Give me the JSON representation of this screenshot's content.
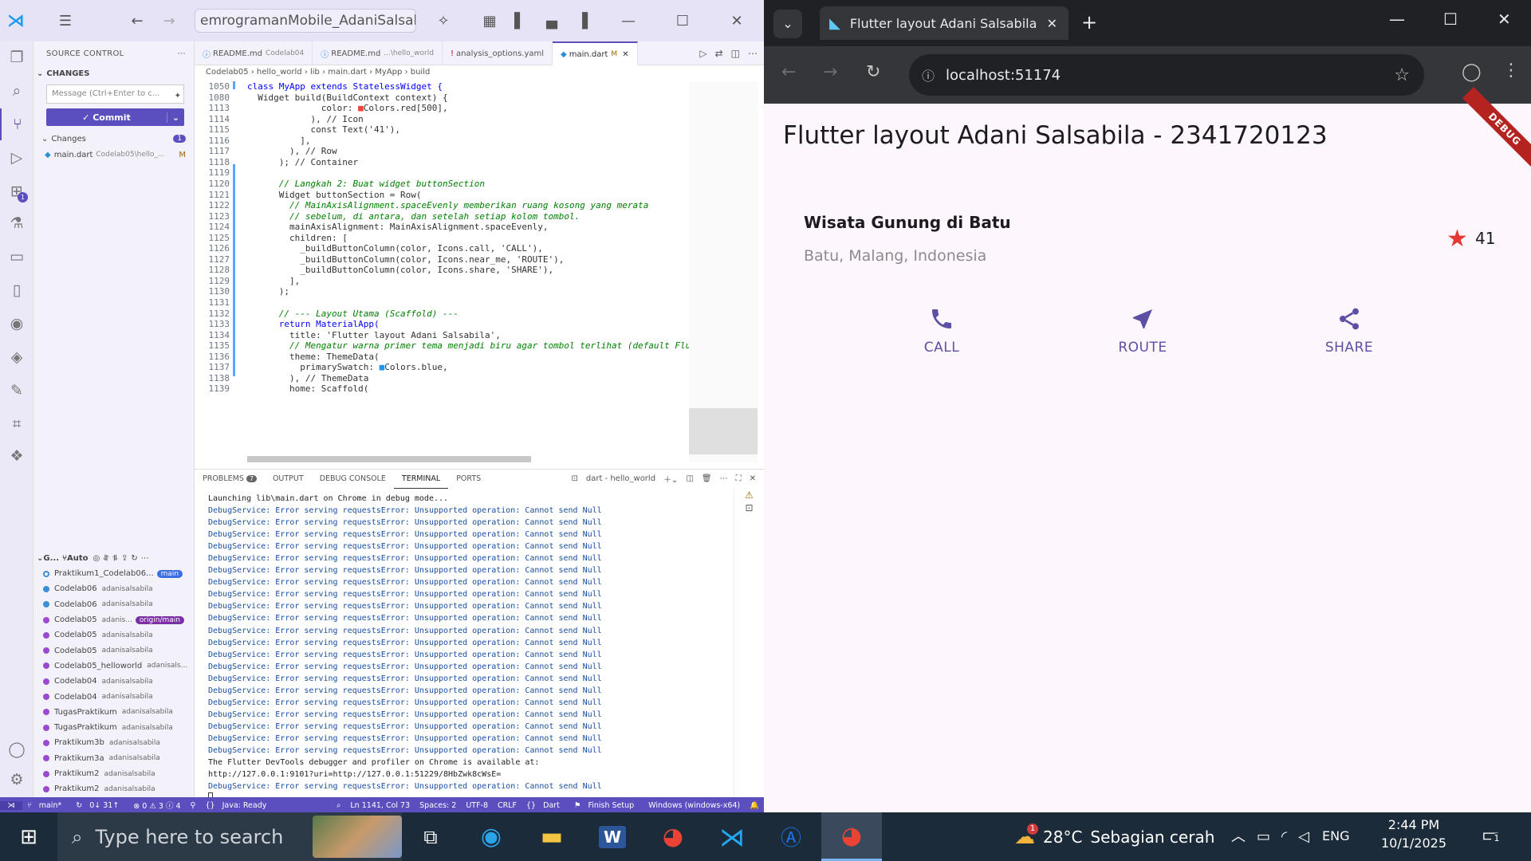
{
  "vscode": {
    "title_search": "emrogramanMobile_AdaniSalsabila",
    "sidebar": {
      "header": "SOURCE CONTROL",
      "changes_section": "CHANGES",
      "message_placeholder": "Message (Ctrl+Enter to c...",
      "commit_label": "Commit",
      "changes_group": "Changes",
      "changes_count": "1",
      "changed_file": "main.dart",
      "changed_file_path": "Codelab05\\hello_...",
      "changed_file_status": "M",
      "graph_header": "G...",
      "graph_auto": "Auto",
      "graph": [
        {
          "msg": "Praktikum1_Codelab06...",
          "author": "",
          "tag": "main"
        },
        {
          "msg": "Codelab06",
          "author": "adanisalsabila",
          "tag": ""
        },
        {
          "msg": "Codelab06",
          "author": "adanisalsabila",
          "tag": ""
        },
        {
          "msg": "Codelab05",
          "author": "adanis...",
          "tag": "origin/main"
        },
        {
          "msg": "Codelab05",
          "author": "adanisalsabila",
          "tag": ""
        },
        {
          "msg": "Codelab05",
          "author": "adanisalsabila",
          "tag": ""
        },
        {
          "msg": "Codelab05_helloworld",
          "author": "adanisals...",
          "tag": ""
        },
        {
          "msg": "Codelab04",
          "author": "adanisalsabila",
          "tag": ""
        },
        {
          "msg": "Codelab04",
          "author": "adanisalsabila",
          "tag": ""
        },
        {
          "msg": "TugasPraktikum",
          "author": "adanisalsabila",
          "tag": ""
        },
        {
          "msg": "TugasPraktikum",
          "author": "adanisalsabila",
          "tag": ""
        },
        {
          "msg": "Praktikum3b",
          "author": "adanisalsabila",
          "tag": ""
        },
        {
          "msg": "Praktikum3a",
          "author": "adanisalsabila",
          "tag": ""
        },
        {
          "msg": "Praktikum2",
          "author": "adanisalsabila",
          "tag": ""
        },
        {
          "msg": "Praktikum2",
          "author": "adanisalsabila",
          "tag": ""
        }
      ]
    },
    "tabs": [
      {
        "label": "README.md",
        "sub": "Codelab04"
      },
      {
        "label": "README.md",
        "sub": "...\\hello_world"
      },
      {
        "label": "analysis_options.yaml",
        "sub": ""
      },
      {
        "label": "main.dart",
        "sub": "M"
      }
    ],
    "breadcrumb": "Codelab05 › hello_world › lib › main.dart › MyApp › build",
    "code_lines": [
      {
        "n": "1050",
        "t": "class MyApp extends StatelessWidget {"
      },
      {
        "n": "1080",
        "t": "  Widget build(BuildContext context) {"
      },
      {
        "n": "1113",
        "t": "              color: ■Colors.red[500],"
      },
      {
        "n": "1114",
        "t": "            ), // Icon"
      },
      {
        "n": "1115",
        "t": "            const Text('41'),"
      },
      {
        "n": "1116",
        "t": "          ],"
      },
      {
        "n": "1117",
        "t": "        ), // Row"
      },
      {
        "n": "1118",
        "t": "      ); // Container"
      },
      {
        "n": "1119",
        "t": ""
      },
      {
        "n": "1120",
        "t": "      // Langkah 2: Buat widget buttonSection"
      },
      {
        "n": "1121",
        "t": "      Widget buttonSection = Row("
      },
      {
        "n": "1122",
        "t": "        // MainAxisAlignment.spaceEvenly memberikan ruang kosong yang merata"
      },
      {
        "n": "1123",
        "t": "        // sebelum, di antara, dan setelah setiap kolom tombol."
      },
      {
        "n": "1124",
        "t": "        mainAxisAlignment: MainAxisAlignment.spaceEvenly,"
      },
      {
        "n": "1125",
        "t": "        children: ["
      },
      {
        "n": "1126",
        "t": "          _buildButtonColumn(color, Icons.call, 'CALL'),"
      },
      {
        "n": "1127",
        "t": "          _buildButtonColumn(color, Icons.near_me, 'ROUTE'),"
      },
      {
        "n": "1128",
        "t": "          _buildButtonColumn(color, Icons.share, 'SHARE'),"
      },
      {
        "n": "1129",
        "t": "        ],"
      },
      {
        "n": "1130",
        "t": "      );"
      },
      {
        "n": "1131",
        "t": ""
      },
      {
        "n": "1132",
        "t": "      // --- Layout Utama (Scaffold) ---"
      },
      {
        "n": "1133",
        "t": "      return MaterialApp("
      },
      {
        "n": "1134",
        "t": "        title: 'Flutter layout Adani Salsabila',"
      },
      {
        "n": "1135",
        "t": "        // Mengatur warna primer tema menjadi biru agar tombol terlihat (default Flu"
      },
      {
        "n": "1136",
        "t": "        theme: ThemeData("
      },
      {
        "n": "1137",
        "t": "          primarySwatch: ■Colors.blue,"
      },
      {
        "n": "1138",
        "t": "        ), // ThemeData"
      },
      {
        "n": "1139",
        "t": "        home: Scaffold("
      }
    ],
    "panel": {
      "problems": "PROBLEMS",
      "problems_count": "7",
      "output": "OUTPUT",
      "debug_console": "DEBUG CONSOLE",
      "terminal": "TERMINAL",
      "ports": "PORTS",
      "terminal_name": "dart - hello_world"
    },
    "terminal_lines": [
      {
        "t": "Launching lib\\main.dart on Chrome in debug mode...",
        "c": "plain"
      },
      {
        "t": "DebugService: Error serving requestsError: Unsupported operation: Cannot send Null",
        "c": "blue"
      },
      {
        "t": "DebugService: Error serving requestsError: Unsupported operation: Cannot send Null",
        "c": "blue"
      },
      {
        "t": "DebugService: Error serving requestsError: Unsupported operation: Cannot send Null",
        "c": "blue"
      },
      {
        "t": "DebugService: Error serving requestsError: Unsupported operation: Cannot send Null",
        "c": "blue"
      },
      {
        "t": "DebugService: Error serving requestsError: Unsupported operation: Cannot send Null",
        "c": "blue"
      },
      {
        "t": "DebugService: Error serving requestsError: Unsupported operation: Cannot send Null",
        "c": "blue"
      },
      {
        "t": "DebugService: Error serving requestsError: Unsupported operation: Cannot send Null",
        "c": "blue"
      },
      {
        "t": "DebugService: Error serving requestsError: Unsupported operation: Cannot send Null",
        "c": "blue"
      },
      {
        "t": "DebugService: Error serving requestsError: Unsupported operation: Cannot send Null",
        "c": "blue"
      },
      {
        "t": "DebugService: Error serving requestsError: Unsupported operation: Cannot send Null",
        "c": "blue"
      },
      {
        "t": "DebugService: Error serving requestsError: Unsupported operation: Cannot send Null",
        "c": "blue"
      },
      {
        "t": "DebugService: Error serving requestsError: Unsupported operation: Cannot send Null",
        "c": "blue"
      },
      {
        "t": "DebugService: Error serving requestsError: Unsupported operation: Cannot send Null",
        "c": "blue"
      },
      {
        "t": "DebugService: Error serving requestsError: Unsupported operation: Cannot send Null",
        "c": "blue"
      },
      {
        "t": "DebugService: Error serving requestsError: Unsupported operation: Cannot send Null",
        "c": "blue"
      },
      {
        "t": "DebugService: Error serving requestsError: Unsupported operation: Cannot send Null",
        "c": "blue"
      },
      {
        "t": "DebugService: Error serving requestsError: Unsupported operation: Cannot send Null",
        "c": "blue"
      },
      {
        "t": "DebugService: Error serving requestsError: Unsupported operation: Cannot send Null",
        "c": "blue"
      },
      {
        "t": "DebugService: Error serving requestsError: Unsupported operation: Cannot send Null",
        "c": "blue"
      },
      {
        "t": "DebugService: Error serving requestsError: Unsupported operation: Cannot send Null",
        "c": "blue"
      },
      {
        "t": "DebugService: Error serving requestsError: Unsupported operation: Cannot send Null",
        "c": "blue"
      },
      {
        "t": "The Flutter DevTools debugger and profiler on Chrome is available at:",
        "c": "plain"
      },
      {
        "t": "http://127.0.0.1:9101?uri=http://127.0.0.1:51229/8HbZwk8cWsE=",
        "c": "plain"
      },
      {
        "t": "DebugService: Error serving requestsError: Unsupported operation: Cannot send Null",
        "c": "blue"
      }
    ],
    "status": {
      "branch": "main*",
      "sync": "0↓ 31↑",
      "problems": "⊗ 0 ⚠ 3 ⓘ 4",
      "java": "Java: Ready",
      "position": "Ln 1141, Col 73",
      "spaces": "Spaces: 2",
      "encoding": "UTF-8",
      "eol": "CRLF",
      "language": "Dart",
      "finish_setup": "Finish Setup",
      "device": "Windows (windows-x64)"
    }
  },
  "chrome": {
    "tab_title": "Flutter layout Adani Salsabila",
    "url": "localhost:51174",
    "app": {
      "debug_banner": "DEBUG",
      "title": "Flutter layout Adani Salsabila - 2341720123",
      "place_name": "Wisata Gunung di Batu",
      "place_location": "Batu, Malang, Indonesia",
      "star_count": "41",
      "buttons": [
        {
          "label": "CALL",
          "icon": "phone-icon"
        },
        {
          "label": "ROUTE",
          "icon": "near-me-icon"
        },
        {
          "label": "SHARE",
          "icon": "share-icon"
        }
      ],
      "accent_color": "#5d4fa3",
      "star_color": "#e53935"
    }
  },
  "taskbar": {
    "search_placeholder": "Type here to search",
    "weather_temp": "28°C",
    "weather_text": "Sebagian cerah",
    "weather_badge": "1",
    "language": "ENG",
    "time": "2:44 PM",
    "date": "10/1/2025",
    "notif_count": "1"
  }
}
